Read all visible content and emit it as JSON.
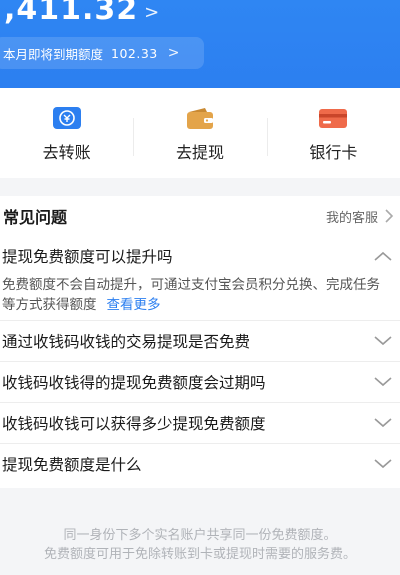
{
  "header": {
    "amount": ",411.32",
    "amount_chevron": ">",
    "quota_label": "本月即将到期额度",
    "quota_value": "102.33",
    "quota_chevron": ">"
  },
  "actions": [
    {
      "label": "去转账",
      "icon": "transfer-icon",
      "color": "#2c7ff0"
    },
    {
      "label": "去提现",
      "icon": "wallet-icon",
      "color": "#e3a44a"
    },
    {
      "label": "银行卡",
      "icon": "bank-card-icon",
      "color": "#ef6a4a"
    }
  ],
  "faq": {
    "title": "常见问题",
    "service_label": "我的客服",
    "expanded": {
      "question": "提现免费额度可以提升吗",
      "answer": "免费额度不会自动提升，可通过支付宝会员积分兑换、完成任务等方式获得额度",
      "more": "查看更多"
    },
    "questions": [
      "通过收钱码收钱的交易提现是否免费",
      "收钱码收钱得的提现免费额度会过期吗",
      "收钱码收钱可以获得多少提现免费额度",
      "提现免费额度是什么"
    ]
  },
  "note": {
    "line1": "同一身份下多个实名账户共享同一份免费额度。",
    "line2": "免费额度可用于免除转账到卡或提现时需要的服务费。"
  },
  "colors": {
    "brand_blue": "#2c7ff0",
    "page_bg": "#f4f5f7"
  }
}
